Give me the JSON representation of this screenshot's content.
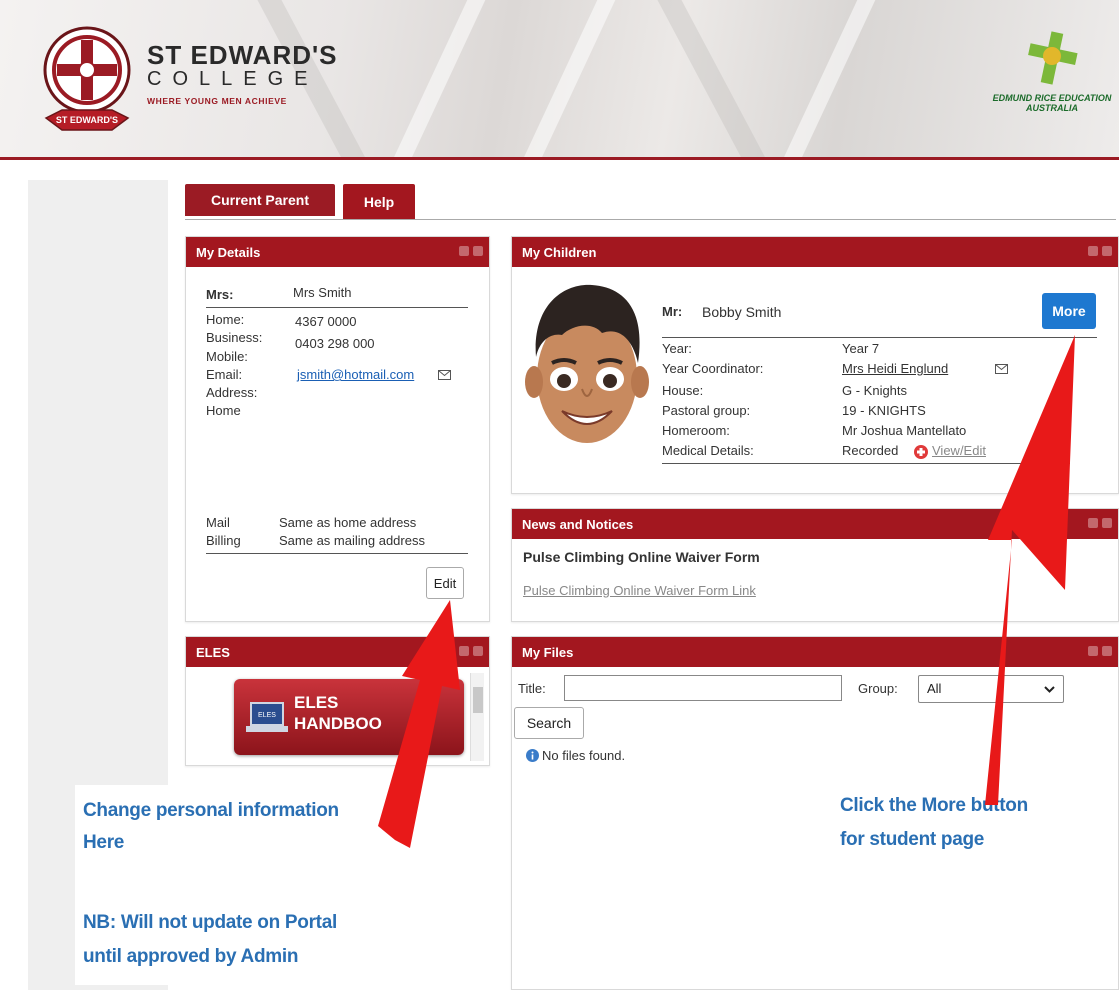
{
  "header": {
    "college_line1": "ST EDWARD'S",
    "college_line2": "COLLEGE",
    "tagline": "WHERE YOUNG MEN ACHIEVE",
    "crest_banner": "ST EDWARD'S",
    "erea_line1": "EDMUND RICE EDUCATION",
    "erea_line2": "AUSTRALIA"
  },
  "tabs": [
    {
      "label": "Current Parent"
    },
    {
      "label": "Help"
    }
  ],
  "my_details": {
    "title": "My Details",
    "title_label": "Mrs:",
    "name": "Mrs Smith",
    "home_label": "Home:",
    "home": "4367 0000",
    "business_label": "Business:",
    "business": "0403 298 000",
    "mobile_label": "Mobile:",
    "email_label": "Email:",
    "email": "jsmith@hotmail.com",
    "address_label": "Address:",
    "address_sub": "Home",
    "mail_label": "Mail",
    "mail_value": "Same as home address",
    "billing_label": "Billing",
    "billing_value": "Same as mailing address",
    "edit_label": "Edit"
  },
  "eles": {
    "title": "ELES",
    "banner_line1": "ELES",
    "banner_line2": "HANDBOO",
    "laptop_tag": "ELES"
  },
  "my_children": {
    "title": "My Children",
    "title_label": "Mr:",
    "name": "Bobby Smith",
    "more_label": "More",
    "rows": [
      {
        "label": "Year:",
        "value": "Year 7"
      },
      {
        "label": "Year Coordinator:",
        "value": "Mrs Heidi Englund"
      },
      {
        "label": "House:",
        "value": "G - Knights"
      },
      {
        "label": "Pastoral group:",
        "value": "19 - KNIGHTS"
      },
      {
        "label": "Homeroom:",
        "value": "Mr Joshua Mantellato"
      },
      {
        "label": "Medical Details:",
        "value": "Recorded"
      }
    ],
    "medical_link": "View/Edit"
  },
  "news": {
    "title": "News and Notices",
    "headline": "Pulse Climbing Online Waiver Form",
    "link": "Pulse Climbing Online Waiver Form Link"
  },
  "my_files": {
    "title": "My Files",
    "title_label": "Title:",
    "title_value": "",
    "group_label": "Group:",
    "group_value": "All",
    "search_label": "Search",
    "empty_text": "No files found."
  },
  "callouts": {
    "left_l1": "Change personal information",
    "left_l2": "Here",
    "left_l3": "NB: Will not update on Portal",
    "left_l4": "until approved by Admin",
    "right_l1": "Click the More button",
    "right_l2": "for student page"
  },
  "colors": {
    "brand_red": "#a3171f",
    "more_blue": "#1e78d0",
    "callout_blue": "#2a6fb3",
    "arrow_red": "#e81919"
  }
}
